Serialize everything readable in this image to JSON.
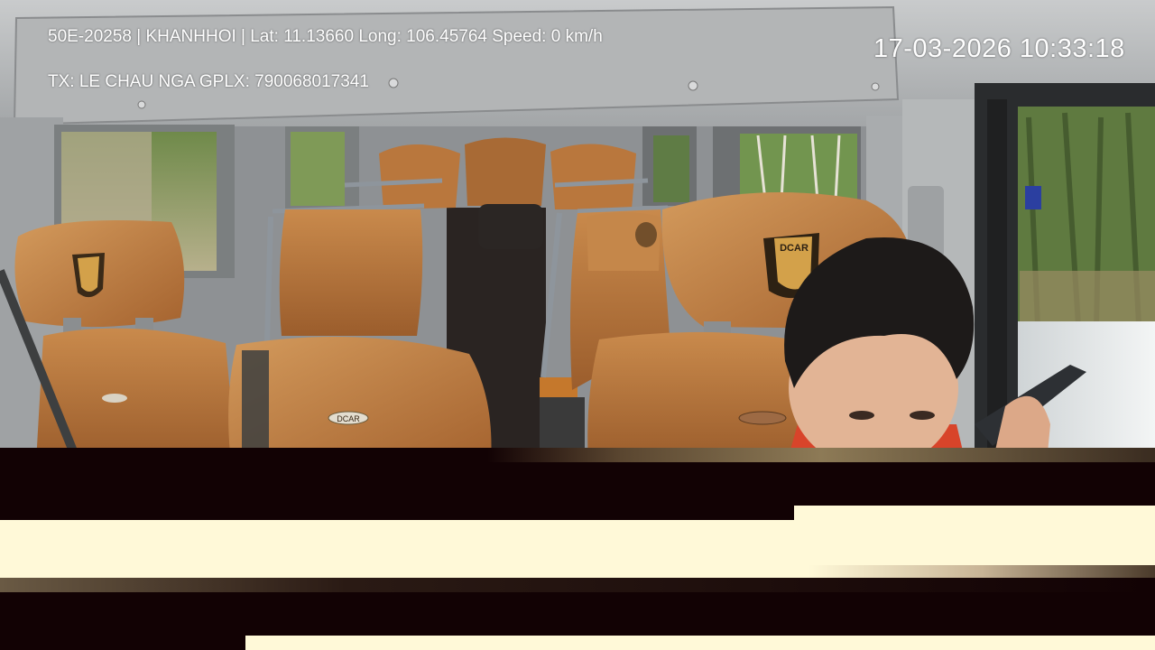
{
  "overlay": {
    "line1": "50E-20258 | KHANHHOI | Lat: 11.13660 Long: 106.45764 Speed: 0 km/h",
    "line2": "TX: LE CHAU NGA GPLX: 790068017341",
    "timestamp": "17-03-2026 10:33:18"
  },
  "brand": {
    "headrest_logo": "DCAR",
    "seat_badge": "DCAR"
  },
  "colors": {
    "leather": "#b8743a",
    "corrupt_dark": "#120204",
    "corrupt_light": "#fff9d8"
  }
}
